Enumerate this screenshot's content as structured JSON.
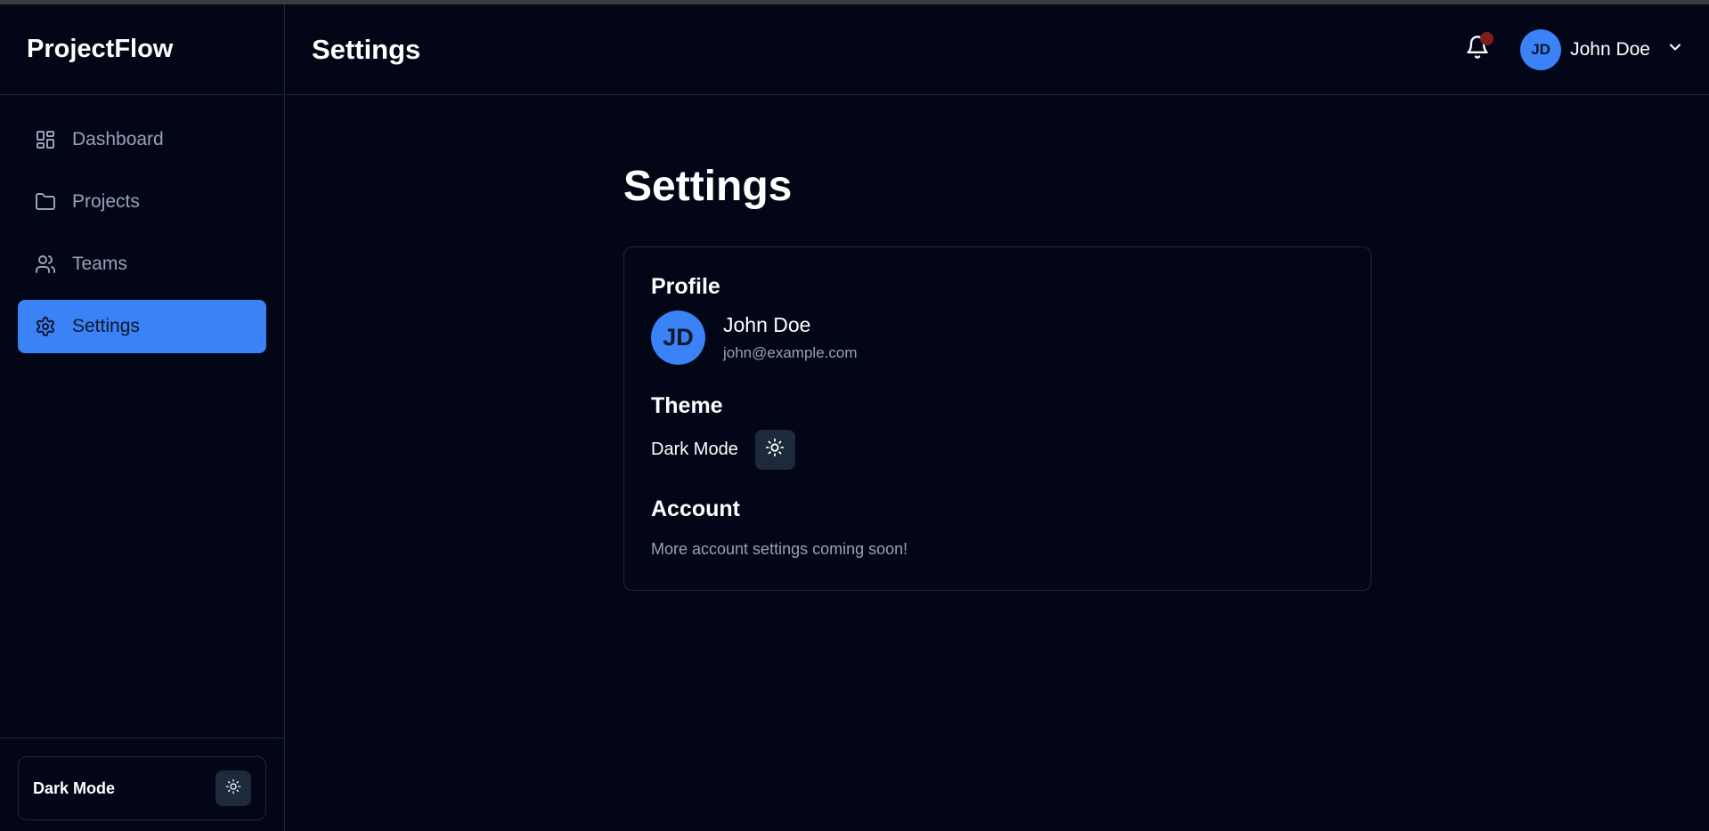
{
  "app": {
    "brand": "ProjectFlow"
  },
  "sidebar": {
    "items": [
      {
        "label": "Dashboard",
        "icon": "dashboard-icon",
        "active": false
      },
      {
        "label": "Projects",
        "icon": "folder-icon",
        "active": false
      },
      {
        "label": "Teams",
        "icon": "users-icon",
        "active": false
      },
      {
        "label": "Settings",
        "icon": "gear-icon",
        "active": true
      }
    ],
    "footer": {
      "theme_label": "Dark Mode",
      "theme_icon": "sun-icon"
    }
  },
  "header": {
    "title": "Settings",
    "notifications_icon": "bell-icon",
    "user": {
      "initials": "JD",
      "name": "John Doe",
      "menu_icon": "chevron-down-icon"
    }
  },
  "main": {
    "title": "Settings",
    "profile": {
      "heading": "Profile",
      "initials": "JD",
      "name": "John Doe",
      "email": "john@example.com"
    },
    "theme": {
      "heading": "Theme",
      "label": "Dark Mode",
      "icon": "sun-icon"
    },
    "account": {
      "heading": "Account",
      "note": "More account settings coming soon!"
    }
  },
  "colors": {
    "background": "#020617",
    "border": "#1e293b",
    "accent": "#3b82f6",
    "muted_text": "#94a3b8",
    "notification_dot": "#7f1d1d"
  }
}
